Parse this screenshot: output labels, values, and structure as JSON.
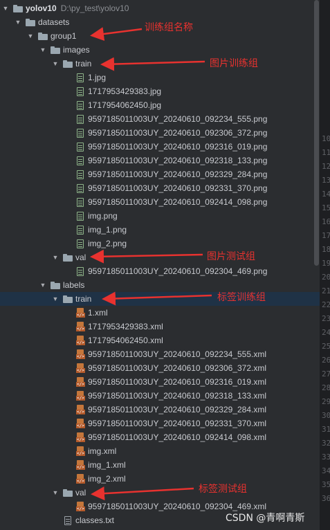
{
  "tree": [
    {
      "name": "yolov10",
      "path": "D:\\py_test\\yolov10",
      "type": "folder",
      "depth": 0,
      "expanded": true,
      "bold": true
    },
    {
      "name": "datasets",
      "type": "folder",
      "depth": 1,
      "expanded": true
    },
    {
      "name": "group1",
      "type": "folder",
      "depth": 2,
      "expanded": true
    },
    {
      "name": "images",
      "type": "folder",
      "depth": 3,
      "expanded": true
    },
    {
      "name": "train",
      "type": "folder",
      "depth": 4,
      "expanded": true
    },
    {
      "name": "1.jpg",
      "type": "image",
      "depth": 5
    },
    {
      "name": "1717953429383.jpg",
      "type": "image",
      "depth": 5
    },
    {
      "name": "1717954062450.jpg",
      "type": "image",
      "depth": 5
    },
    {
      "name": "9597185011003UY_20240610_092234_555.png",
      "type": "image",
      "depth": 5
    },
    {
      "name": "9597185011003UY_20240610_092306_372.png",
      "type": "image",
      "depth": 5
    },
    {
      "name": "9597185011003UY_20240610_092316_019.png",
      "type": "image",
      "depth": 5
    },
    {
      "name": "9597185011003UY_20240610_092318_133.png",
      "type": "image",
      "depth": 5
    },
    {
      "name": "9597185011003UY_20240610_092329_284.png",
      "type": "image",
      "depth": 5
    },
    {
      "name": "9597185011003UY_20240610_092331_370.png",
      "type": "image",
      "depth": 5
    },
    {
      "name": "9597185011003UY_20240610_092414_098.png",
      "type": "image",
      "depth": 5
    },
    {
      "name": "img.png",
      "type": "image",
      "depth": 5
    },
    {
      "name": "img_1.png",
      "type": "image",
      "depth": 5
    },
    {
      "name": "img_2.png",
      "type": "image",
      "depth": 5
    },
    {
      "name": "val",
      "type": "folder",
      "depth": 4,
      "expanded": true
    },
    {
      "name": "9597185011003UY_20240610_092304_469.png",
      "type": "image",
      "depth": 5
    },
    {
      "name": "labels",
      "type": "folder",
      "depth": 3,
      "expanded": true
    },
    {
      "name": "train",
      "type": "folder",
      "depth": 4,
      "expanded": true,
      "selected": true
    },
    {
      "name": "1.xml",
      "type": "xml",
      "depth": 5
    },
    {
      "name": "1717953429383.xml",
      "type": "xml",
      "depth": 5
    },
    {
      "name": "1717954062450.xml",
      "type": "xml",
      "depth": 5
    },
    {
      "name": "9597185011003UY_20240610_092234_555.xml",
      "type": "xml",
      "depth": 5
    },
    {
      "name": "9597185011003UY_20240610_092306_372.xml",
      "type": "xml",
      "depth": 5
    },
    {
      "name": "9597185011003UY_20240610_092316_019.xml",
      "type": "xml",
      "depth": 5
    },
    {
      "name": "9597185011003UY_20240610_092318_133.xml",
      "type": "xml",
      "depth": 5
    },
    {
      "name": "9597185011003UY_20240610_092329_284.xml",
      "type": "xml",
      "depth": 5
    },
    {
      "name": "9597185011003UY_20240610_092331_370.xml",
      "type": "xml",
      "depth": 5
    },
    {
      "name": "9597185011003UY_20240610_092414_098.xml",
      "type": "xml",
      "depth": 5
    },
    {
      "name": "img.xml",
      "type": "xml",
      "depth": 5
    },
    {
      "name": "img_1.xml",
      "type": "xml",
      "depth": 5
    },
    {
      "name": "img_2.xml",
      "type": "xml",
      "depth": 5
    },
    {
      "name": "val",
      "type": "folder",
      "depth": 4,
      "expanded": true
    },
    {
      "name": "9597185011003UY_20240610_092304_469.xml",
      "type": "xml",
      "depth": 5
    },
    {
      "name": "classes.txt",
      "type": "text",
      "depth": 4
    }
  ],
  "annotations": {
    "group_name": "训练组名称",
    "image_train": "图片训练组",
    "image_val": "图片测试组",
    "label_train": "标签训练组",
    "label_val": "标签测试组"
  },
  "gutter_numbers": [
    "10",
    "11",
    "12",
    "13",
    "14",
    "15",
    "16",
    "17",
    "18",
    "19",
    "20",
    "21",
    "22",
    "23",
    "24",
    "25",
    "26",
    "27",
    "28",
    "29",
    "30",
    "31",
    "32",
    "33",
    "34",
    "35",
    "36"
  ],
  "watermark": "CSDN @青啊青斯",
  "colors": {
    "background": "#2b2d30",
    "selection": "#1f3246",
    "annotation_red": "#e8322f",
    "folder": "#9aa7b0",
    "image_icon": "#8fb58a",
    "xml_icon": "#c4763b"
  }
}
